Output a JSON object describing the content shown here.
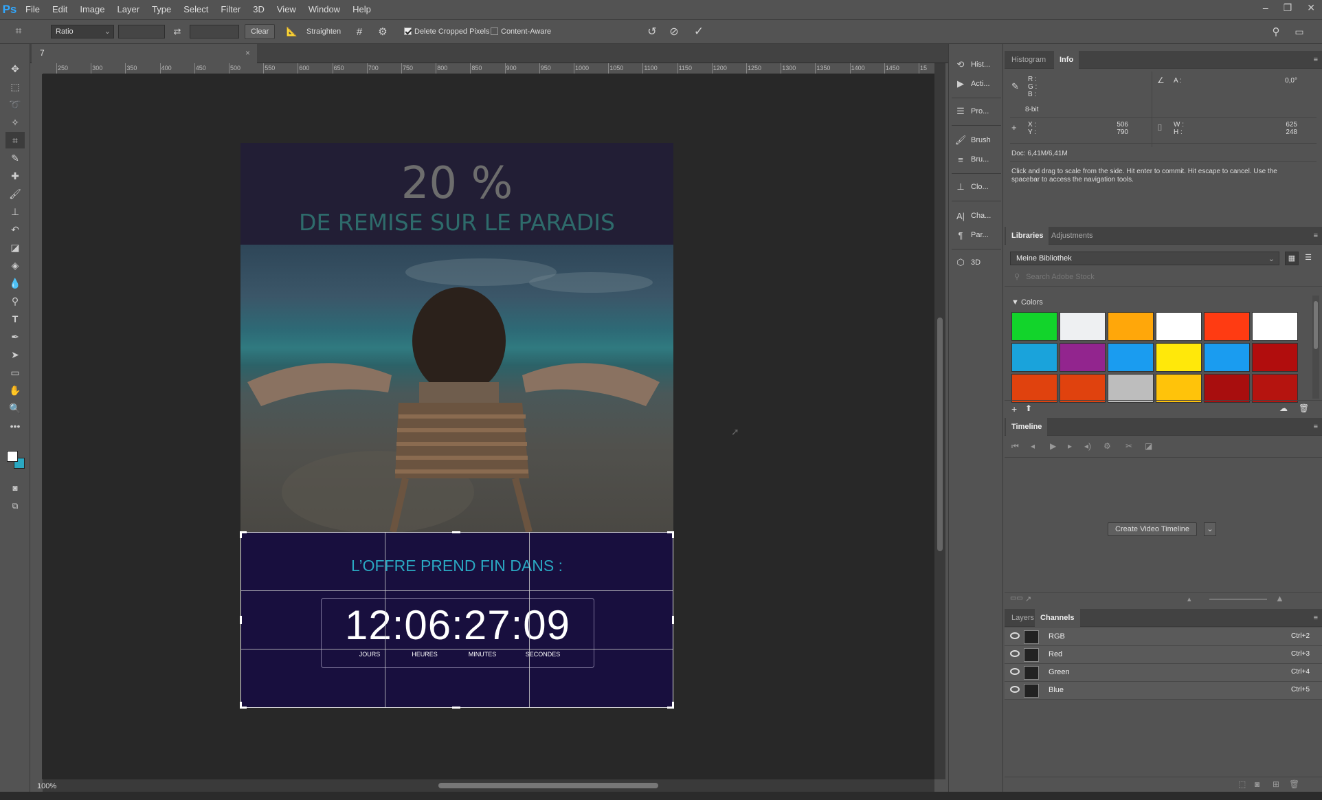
{
  "app": {
    "logo": "Ps"
  },
  "menu": [
    "File",
    "Edit",
    "Image",
    "Layer",
    "Type",
    "Select",
    "Filter",
    "3D",
    "View",
    "Window",
    "Help"
  ],
  "options": {
    "ratio_label": "Ratio",
    "clear_label": "Clear",
    "straighten_label": "Straighten",
    "delete_cropped_label": "Delete Cropped Pixels",
    "content_aware_label": "Content-Aware"
  },
  "document": {
    "tab_title": "7",
    "zoom": "100%"
  },
  "ruler_ticks": [
    "250",
    "300",
    "350",
    "400",
    "450",
    "500",
    "550",
    "600",
    "650",
    "700",
    "750",
    "800",
    "850",
    "900",
    "950",
    "1000",
    "1050",
    "1100",
    "1150",
    "1200",
    "1250",
    "1300",
    "1350",
    "1400",
    "1450",
    "15"
  ],
  "artwork": {
    "percent": "20 %",
    "subtitle": "DE REMISE SUR LE PARADIS",
    "offer": "L’OFFRE PREND FIN DANS :",
    "countdown": "12:06:27:09",
    "labels": [
      "JOURS",
      "HEURES",
      "MINUTES",
      "SECONDES"
    ]
  },
  "dock": [
    "Hist...",
    "Acti...",
    "Pro...",
    "Brush",
    "Bru...",
    "Clo...",
    "Cha...",
    "Par...",
    "3D"
  ],
  "info_panel": {
    "tabs": [
      "Histogram",
      "Info"
    ],
    "rgb_labels": "R :\nG :\nB :",
    "bit_depth": "8-bit",
    "angle_label": "A :",
    "angle_value": "0,0°",
    "xy_labels": "X :\nY :",
    "x_value": "506",
    "y_value": "790",
    "wh_labels": "W :\nH :",
    "w_value": "625",
    "h_value": "248",
    "doc_size": "Doc: 6,41M/6,41M",
    "hint": "Click and drag to scale from the side. Hit enter to commit. Hit escape to cancel. Use the spacebar to access the navigation tools."
  },
  "libraries_panel": {
    "tabs": [
      "Libraries",
      "Adjustments"
    ],
    "library_name": "Meine Bibliothek",
    "search_placeholder": "Search Adobe Stock",
    "colors_heading": "Colors",
    "swatches": [
      "#12d42b",
      "#eef0f2",
      "#ffa70a",
      "#ffffff",
      "#ff3b12",
      "#ffffff",
      "#1aa3db",
      "#92258e",
      "#1a9cf0",
      "#ffe80a",
      "#1a9cf0",
      "#b10d0d",
      "#e0420e",
      "#e0420e",
      "#bdbdbd",
      "#ffc30a",
      "#a80e0e",
      "#b5140f"
    ]
  },
  "timeline_panel": {
    "tab": "Timeline",
    "create_label": "Create Video Timeline"
  },
  "channels_panel": {
    "tabs": [
      "Layers",
      "Channels"
    ],
    "rows": [
      {
        "name": "RGB",
        "shortcut": "Ctrl+2"
      },
      {
        "name": "Red",
        "shortcut": "Ctrl+3"
      },
      {
        "name": "Green",
        "shortcut": "Ctrl+4"
      },
      {
        "name": "Blue",
        "shortcut": "Ctrl+5"
      }
    ]
  }
}
